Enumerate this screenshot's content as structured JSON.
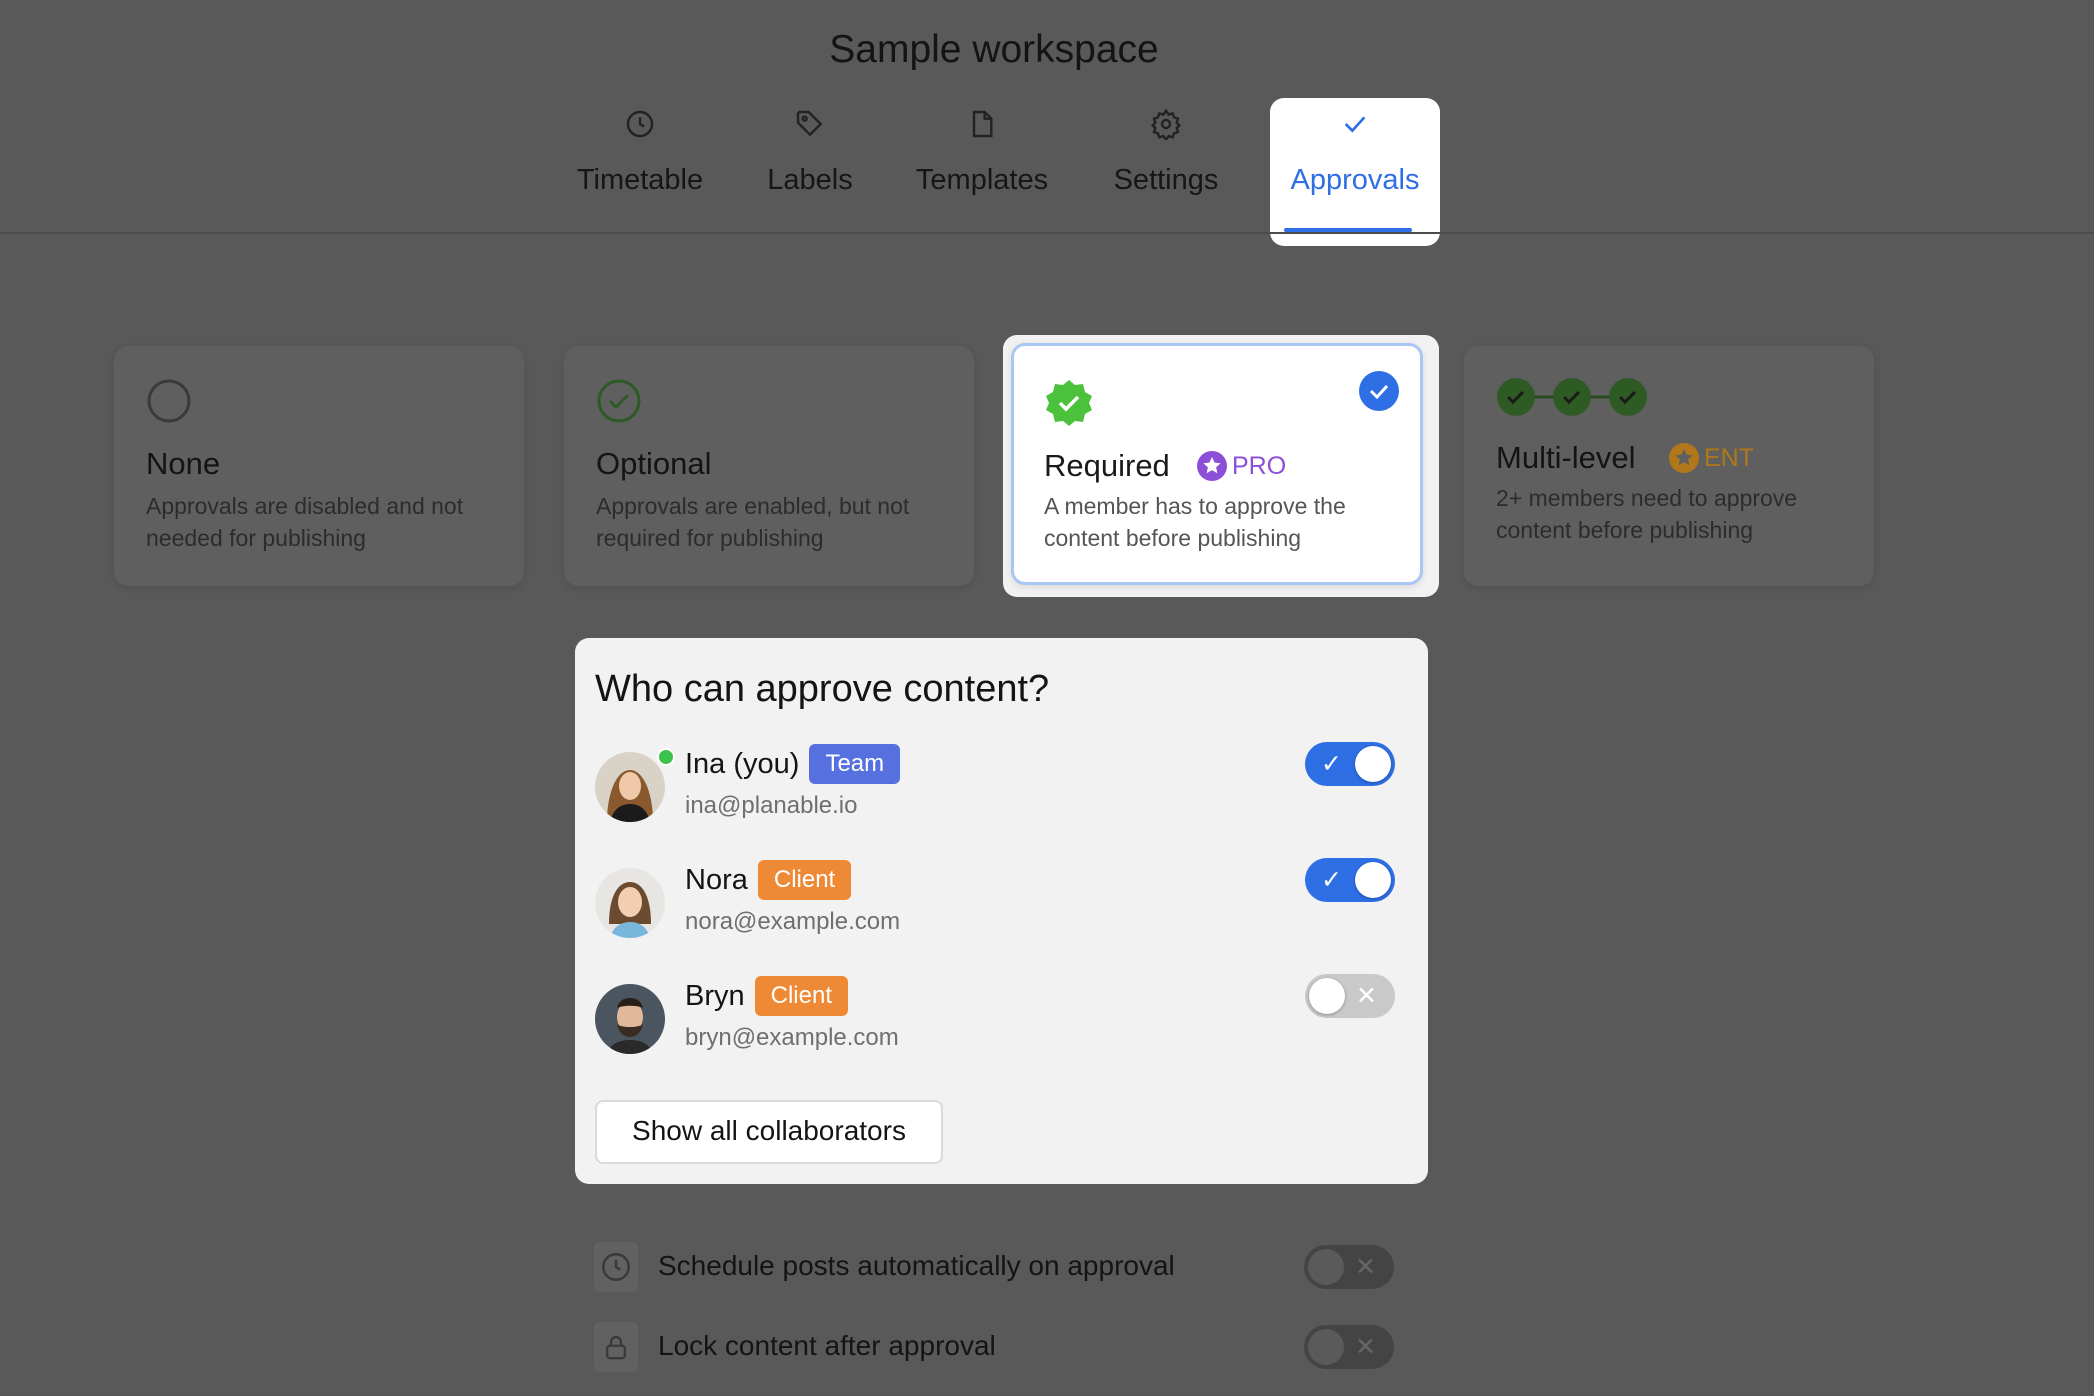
{
  "workspace_title": "Sample workspace",
  "tabs": [
    {
      "label": "Timetable",
      "icon": "clock-icon",
      "active": false
    },
    {
      "label": "Labels",
      "icon": "tag-icon",
      "active": false
    },
    {
      "label": "Templates",
      "icon": "file-icon",
      "active": false
    },
    {
      "label": "Settings",
      "icon": "gear-icon",
      "active": false
    },
    {
      "label": "Approvals",
      "icon": "check-icon",
      "active": true
    }
  ],
  "approval_modes": [
    {
      "title": "None",
      "description": "Approvals are disabled and not needed for publishing",
      "selected": false
    },
    {
      "title": "Optional",
      "description": "Approvals are enabled, but not required for publishing",
      "selected": false
    },
    {
      "title": "Required",
      "badge": "PRO",
      "description": "A member has to approve the content before publishing",
      "selected": true
    },
    {
      "title": "Multi-level",
      "badge": "ENT",
      "description": "2+ members need to approve content before publishing",
      "selected": false
    }
  ],
  "approvers_panel": {
    "heading": "Who can approve content?",
    "members": [
      {
        "name": "Ina (you)",
        "role": "Team",
        "email": "ina@planable.io",
        "enabled": true,
        "online": true
      },
      {
        "name": "Nora",
        "role": "Client",
        "email": "nora@example.com",
        "enabled": true
      },
      {
        "name": "Bryn",
        "role": "Client",
        "email": "bryn@example.com",
        "enabled": false
      }
    ],
    "show_all_label": "Show all collaborators"
  },
  "options": [
    {
      "label": "Schedule posts automatically on approval",
      "icon": "clock-icon",
      "enabled": false
    },
    {
      "label": "Lock content after approval",
      "icon": "lock-icon",
      "enabled": false
    }
  ],
  "toggle_on_symbol": "✓",
  "toggle_off_symbol": "✕",
  "colors": {
    "accent": "#2f6fe6",
    "team_badge": "#5670e0",
    "client_badge": "#ee8a36",
    "pro": "#8b4fd8",
    "ent": "#d08a1c",
    "success": "#3cc24a"
  }
}
